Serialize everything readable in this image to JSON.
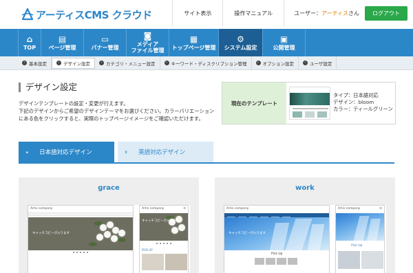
{
  "header": {
    "logo_text": "アーティスCMS クラウド",
    "links": [
      "サイト表示",
      "操作マニュアル"
    ],
    "user_label": "ユーザー：",
    "user_name": "アーティス",
    "user_suffix": "さん",
    "logout_label": "ログアウト"
  },
  "mainnav": [
    {
      "label_lines": [
        "TOP"
      ],
      "icon": "home-icon",
      "glyph": "⌂"
    },
    {
      "label_lines": [
        "ページ管理"
      ],
      "icon": "pages-icon",
      "glyph": "▤"
    },
    {
      "label_lines": [
        "バナー管理"
      ],
      "icon": "banner-icon",
      "glyph": "▭"
    },
    {
      "label_lines": [
        "メディア",
        "ファイル管理"
      ],
      "icon": "camera-icon",
      "glyph": "◙"
    },
    {
      "label_lines": [
        "トップページ管理"
      ],
      "icon": "layout-icon",
      "glyph": "▦"
    },
    {
      "label_lines": [
        "システム設定"
      ],
      "icon": "gears-icon",
      "glyph": "⚙",
      "active": true
    },
    {
      "label_lines": [
        "公開管理"
      ],
      "icon": "monitor-icon",
      "glyph": "▣"
    }
  ],
  "subnav": [
    {
      "label": "基本設定"
    },
    {
      "label": "デザイン設定",
      "active": true
    },
    {
      "label": "カテゴリ・メニュー設定"
    },
    {
      "label": "キーワード・ディスクリプション管理"
    },
    {
      "label": "オプション設定"
    },
    {
      "label": "ユーザ設定"
    }
  ],
  "page": {
    "title": "デザイン設定",
    "intro": [
      "デザインテンプレートの設定・変更が行えます。",
      "下記のデザインからご希望のデザインテーマをお選びください。カラーバリエーション",
      "にある色をクリックすると、実際のトップページイメージをご確認いただけます。"
    ]
  },
  "current_template": {
    "label": "現在のテンプレート",
    "info": [
      "タイプ：日本語対応",
      "デザイン：bloom",
      "カラー：ティールグリーン"
    ]
  },
  "tabs": [
    {
      "label": "日本語対応デザイン",
      "active": true
    },
    {
      "label": "英語対応デザイン",
      "active": false
    }
  ],
  "designs": [
    {
      "name": "grace",
      "site_name": "Artis company",
      "hero_copy": "キャッチコピーが入ります",
      "pickup": "PICK UP"
    },
    {
      "name": "work",
      "site_name": "Artis company",
      "hero_copy": "キャッチコピーが入ります",
      "pickup": "Pick Up"
    }
  ],
  "colors": {
    "brand_blue": "#2c87c8",
    "nav_active": "#1d5f94",
    "logout_green": "#2aa84a",
    "current_label_bg": "#dff0d8",
    "user_name": "#e07b00"
  }
}
